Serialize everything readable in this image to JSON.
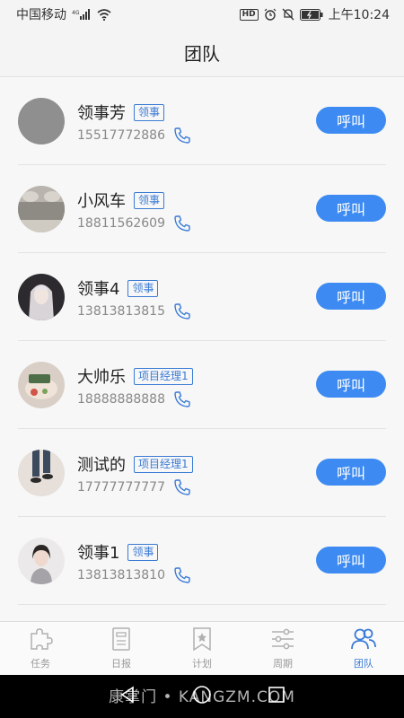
{
  "status_bar": {
    "carrier": "中国移动",
    "network": "4G",
    "hd": "HD",
    "time": "上午10:24"
  },
  "header": {
    "title": "团队"
  },
  "contacts": [
    {
      "name": "领事芳",
      "role": "领事",
      "phone": "15517772886",
      "call_label": "呼叫",
      "avatar": "gray-placeholder"
    },
    {
      "name": "小风车",
      "role": "领事",
      "phone": "18811562609",
      "call_label": "呼叫",
      "avatar": "car-interior"
    },
    {
      "name": "领事4",
      "role": "领事",
      "phone": "13813813815",
      "call_label": "呼叫",
      "avatar": "anime-girl"
    },
    {
      "name": "大帅乐",
      "role": "项目经理1",
      "phone": "18888888888",
      "call_label": "呼叫",
      "avatar": "cake"
    },
    {
      "name": "测试的",
      "role": "项目经理1",
      "phone": "17777777777",
      "call_label": "呼叫",
      "avatar": "legs-photo"
    },
    {
      "name": "领事1",
      "role": "领事",
      "phone": "13813813810",
      "call_label": "呼叫",
      "avatar": "woman-portrait"
    }
  ],
  "tabs": [
    {
      "label": "任务",
      "icon": "puzzle-icon",
      "active": false
    },
    {
      "label": "日报",
      "icon": "document-icon",
      "active": false
    },
    {
      "label": "计划",
      "icon": "bookmark-star-icon",
      "active": false
    },
    {
      "label": "周期",
      "icon": "sliders-icon",
      "active": false
    },
    {
      "label": "团队",
      "icon": "people-icon",
      "active": true
    }
  ],
  "watermark": "康掌门 • KANGZM.COM",
  "colors": {
    "accent": "#3d8bf2",
    "role_badge": "#3a7bd5",
    "tab_inactive": "#9a9a9a"
  }
}
